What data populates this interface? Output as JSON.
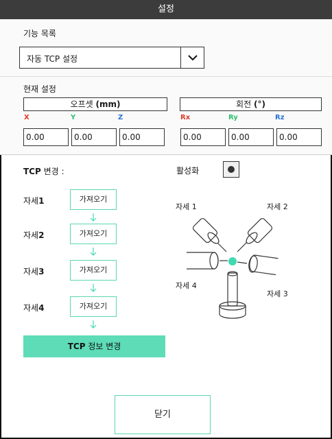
{
  "window": {
    "title": "설정"
  },
  "function_list": {
    "label": "기능 목록",
    "selected": "자동 TCP 설정",
    "dropdown_icon": "chevron-down-icon"
  },
  "current_settings": {
    "label": "현재 설정",
    "offset_header": "오프셋",
    "offset_unit": "(mm)",
    "rotation_header": "회전",
    "rotation_unit": "(°)",
    "axes": [
      {
        "name": "X",
        "value": "0.00",
        "color": "#e0392b"
      },
      {
        "name": "Y",
        "value": "0.00",
        "color": "#2fbf71"
      },
      {
        "name": "Z",
        "value": "0.00",
        "color": "#2a73d6"
      },
      {
        "name": "Rx",
        "value": "0.00",
        "color": "#e0392b"
      },
      {
        "name": "Ry",
        "value": "0.00",
        "color": "#2fbf71"
      },
      {
        "name": "Rz",
        "value": "0.00",
        "color": "#2a73d6"
      }
    ]
  },
  "tcp_change": {
    "label_bold": "TCP",
    "label_rest": " 변경 :",
    "active_label": "활성화",
    "steps": [
      {
        "label": "자세",
        "num": "1",
        "button": "가져오기"
      },
      {
        "label": "자세",
        "num": "2",
        "button": "가져오기"
      },
      {
        "label": "자세",
        "num": "3",
        "button": "가져오기"
      },
      {
        "label": "자세",
        "num": "4",
        "button": "가져오기"
      }
    ],
    "apply_bold": "TCP",
    "apply_rest": " 정보 변경"
  },
  "diagram": {
    "pose1": "자세 1",
    "pose2": "자세 2",
    "pose3": "자세 3",
    "pose4": "자세 4",
    "accent": "#3fd9b0"
  },
  "footer": {
    "close_label": "닫기"
  }
}
